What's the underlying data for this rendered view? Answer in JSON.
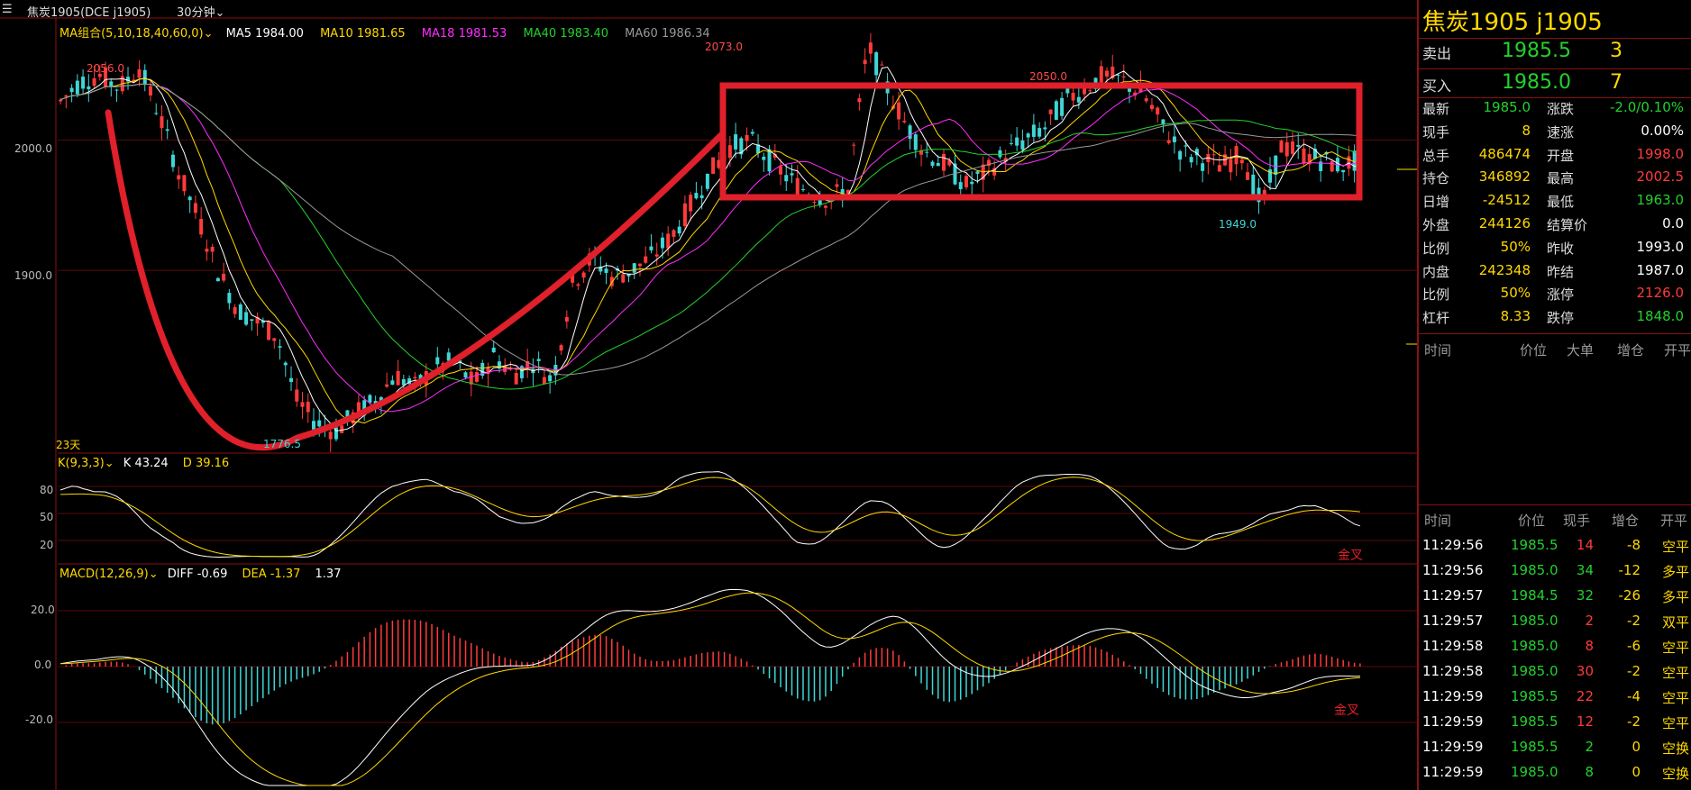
{
  "toolbar": {
    "contract": "焦炭1905(DCE j1905)",
    "period": "30分钟"
  },
  "main_legend": {
    "combo": "MA组合(5,10,18,40,60,0)",
    "ma5": "MA5 1984.00",
    "ma10": "MA10 1981.65",
    "ma18": "MA18 1981.53",
    "ma40": "MA40 1983.40",
    "ma60": "MA60 1986.34"
  },
  "colors": {
    "up": "#ff3b3b",
    "down": "#3fd6d6",
    "ma5": "#ffffff",
    "ma10": "#ffd800",
    "ma18": "#ff2dff",
    "ma40": "#23d12d",
    "ma60": "#999999",
    "annotation": "#e0202a"
  },
  "main_axis": {
    "ticks": [
      "2000.0",
      "1900.0"
    ]
  },
  "main_annotations": {
    "high1": "2056.0",
    "high2": "2073.0",
    "high3": "2050.0",
    "low1": "1776.5",
    "low2": "1949.0",
    "days": "23天"
  },
  "kd_legend": {
    "k": "K 43.24",
    "d": "D 39.16"
  },
  "kd_axis": {
    "ticks": [
      "80",
      "50",
      "20"
    ]
  },
  "kd_signal": "金叉",
  "macd_legend": {
    "diff": "DIFF -0.69",
    "dea": "DEA -1.37",
    "macd": "1.37"
  },
  "macd_axis": {
    "ticks": [
      "20.0",
      "0.0",
      "-20.0"
    ]
  },
  "macd_signal": "金叉",
  "chart_data": {
    "type": "candlestick",
    "title": "焦炭1905(DCE j1905)",
    "period": "30分钟",
    "ylim": [
      1770,
      2080
    ],
    "price_path": [
      2030,
      2045,
      2050,
      2040,
      2056,
      2020,
      1975,
      1940,
      1900,
      1870,
      1860,
      1850,
      1800,
      1783,
      1776.5,
      1790,
      1800,
      1820,
      1810,
      1825,
      1830,
      1812,
      1835,
      1820,
      1830,
      1815,
      1890,
      1910,
      1895,
      1900,
      1910,
      1925,
      1950,
      1975,
      1995,
      2000,
      1985,
      1970,
      1960,
      1955,
      1962,
      2073,
      2040,
      2010,
      1990,
      1980,
      1965,
      1975,
      1990,
      2000,
      2010,
      2030,
      2040,
      2050,
      2045,
      2035,
      2010,
      1990,
      1985,
      1980,
      1990,
      1949,
      1995,
      1990,
      1985,
      1980,
      1985
    ],
    "annotated_high": 2073.0,
    "annotated_low": 1776.5
  },
  "quote": {
    "title": "焦炭1905  j1905",
    "ask": {
      "label": "卖出",
      "price": "1985.5",
      "vol": "3"
    },
    "bid": {
      "label": "买入",
      "price": "1985.0",
      "vol": "7"
    },
    "rows": [
      {
        "l1": "最新",
        "v1": "1985.0",
        "c1": "grn",
        "l2": "涨跌",
        "v2": "-2.0/0.10%",
        "c2": "grn"
      },
      {
        "l1": "现手",
        "v1": "8",
        "c1": "yel",
        "l2": "速涨",
        "v2": "0.00%",
        "c2": "wht"
      },
      {
        "l1": "总手",
        "v1": "486474",
        "c1": "yel",
        "l2": "开盘",
        "v2": "1998.0",
        "c2": "red"
      },
      {
        "l1": "持仓",
        "v1": "346892",
        "c1": "yel",
        "l2": "最高",
        "v2": "2002.5",
        "c2": "red"
      },
      {
        "l1": "日增",
        "v1": "-24512",
        "c1": "yel",
        "l2": "最低",
        "v2": "1963.0",
        "c2": "grn"
      },
      {
        "l1": "外盘",
        "v1": "244126",
        "c1": "yel",
        "l2": "结算价",
        "v2": "0.0",
        "c2": "wht"
      },
      {
        "l1": "比例",
        "v1": "50%",
        "c1": "yel",
        "l2": "昨收",
        "v2": "1993.0",
        "c2": "wht"
      },
      {
        "l1": "内盘",
        "v1": "242348",
        "c1": "yel",
        "l2": "昨结",
        "v2": "1987.0",
        "c2": "wht"
      },
      {
        "l1": "比例",
        "v1": "50%",
        "c1": "yel",
        "l2": "涨停",
        "v2": "2126.0",
        "c2": "red"
      },
      {
        "l1": "杠杆",
        "v1": "8.33",
        "c1": "yel",
        "l2": "跌停",
        "v2": "1848.0",
        "c2": "grn"
      }
    ]
  },
  "bigorder": {
    "headers": [
      "时间",
      "价位",
      "大单",
      "增仓",
      "开平"
    ]
  },
  "ticks": {
    "headers": [
      "时间",
      "价位",
      "现手",
      "增仓",
      "开平"
    ],
    "rows": [
      {
        "time": "11:29:56",
        "price": "1985.5",
        "vol": "14",
        "vc": "red",
        "oi": "-8",
        "type": "空平"
      },
      {
        "time": "11:29:56",
        "price": "1985.0",
        "vol": "34",
        "vc": "grn",
        "oi": "-12",
        "type": "多平"
      },
      {
        "time": "11:29:57",
        "price": "1984.5",
        "vol": "32",
        "vc": "grn",
        "oi": "-26",
        "type": "多平"
      },
      {
        "time": "11:29:57",
        "price": "1985.0",
        "vol": "2",
        "vc": "red",
        "oi": "-2",
        "type": "双平"
      },
      {
        "time": "11:29:58",
        "price": "1985.0",
        "vol": "8",
        "vc": "red",
        "oi": "-6",
        "type": "空平"
      },
      {
        "time": "11:29:58",
        "price": "1985.0",
        "vol": "30",
        "vc": "red",
        "oi": "-2",
        "type": "空平"
      },
      {
        "time": "11:29:59",
        "price": "1985.5",
        "vol": "22",
        "vc": "red",
        "oi": "-4",
        "type": "空平"
      },
      {
        "time": "11:29:59",
        "price": "1985.5",
        "vol": "12",
        "vc": "red",
        "oi": "-2",
        "type": "空平"
      },
      {
        "time": "11:29:59",
        "price": "1985.5",
        "vol": "2",
        "vc": "grn",
        "oi": "0",
        "type": "空换"
      },
      {
        "time": "11:29:59",
        "price": "1985.0",
        "vol": "8",
        "vc": "grn",
        "oi": "0",
        "type": "空换"
      }
    ]
  }
}
